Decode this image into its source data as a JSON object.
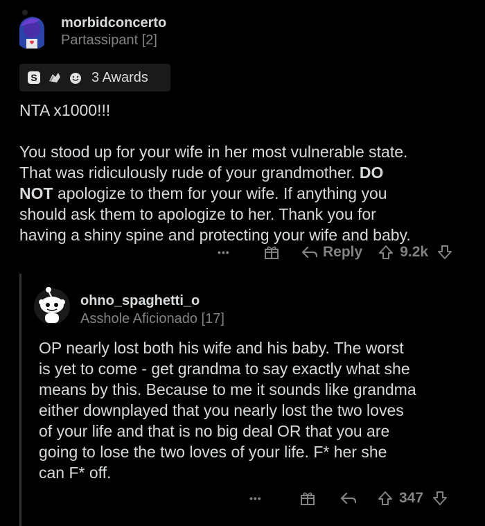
{
  "comment1": {
    "username": "morbidconcerto",
    "flair": "Partassipant [2]",
    "awards_label": "3 Awards",
    "line1": "NTA x1000!!!",
    "p1": "You stood up for your wife in her most vulnerable state.",
    "p2": "That was ridiculously rude of your grandmother. ",
    "p3_bold": "DO",
    "p4_bold": "NOT",
    "p4": " apologize to them for your wife. If anything you",
    "p5": "should ask them to apologize to her. Thank you for",
    "p6": "having a shiny spine and protecting your wife and baby.",
    "more": "•••",
    "reply_label": "Reply",
    "score": "9.2k"
  },
  "comment2": {
    "username": "ohno_spaghetti_o",
    "flair": "Asshole Aficionado [17]",
    "lines": [
      "OP nearly lost both his wife and his baby. The worst",
      "is yet to come - get grandma to say exactly what she",
      "means by this. Because to me it sounds like grandma",
      "either downplayed that you nearly lost the two loves",
      "of your life and that is no big deal OR that you are",
      "going to lose the two loves of your life. F* her she",
      "can F* off."
    ],
    "more": "•••",
    "score": "347"
  },
  "colors": {
    "bg": "#000000",
    "text": "#d7dadc",
    "muted": "#818384",
    "award_bg": "#1a1a1b"
  }
}
